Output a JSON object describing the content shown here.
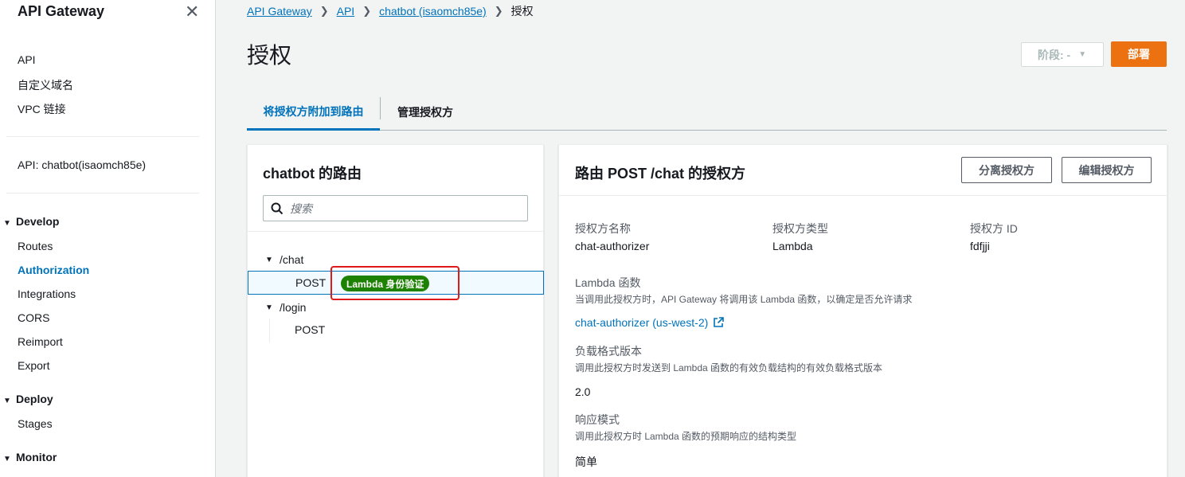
{
  "sidebar": {
    "title": "API Gateway",
    "links_top": [
      "API",
      "自定义域名",
      "VPC 链接"
    ],
    "api_label": "API: chatbot(isaomch85e)",
    "develop": {
      "label": "Develop",
      "items": [
        "Routes",
        "Authorization",
        "Integrations",
        "CORS",
        "Reimport",
        "Export"
      ],
      "active": "Authorization"
    },
    "deploy": {
      "label": "Deploy",
      "items": [
        "Stages"
      ]
    },
    "monitor": {
      "label": "Monitor"
    }
  },
  "breadcrumb": {
    "items": [
      "API Gateway",
      "API",
      "chatbot (isaomch85e)"
    ],
    "current": "授权"
  },
  "page": {
    "title": "授权",
    "stage_label": "阶段: -",
    "deploy_label": "部署"
  },
  "tabs": {
    "attach": "将授权方附加到路由",
    "manage": "管理授权方"
  },
  "routes_panel": {
    "title": "chatbot 的路由",
    "search_placeholder": "搜索",
    "routes": [
      {
        "path": "/chat",
        "method": "POST",
        "badge": "Lambda 身份验证",
        "selected": true
      },
      {
        "path": "/login",
        "method": "POST"
      }
    ]
  },
  "authorizer_panel": {
    "title": "路由 POST /chat 的授权方",
    "detach_label": "分离授权方",
    "edit_label": "编辑授权方",
    "name_label": "授权方名称",
    "name_value": "chat-authorizer",
    "type_label": "授权方类型",
    "type_value": "Lambda",
    "id_label": "授权方 ID",
    "id_value": "fdfjji",
    "lambda_label": "Lambda 函数",
    "lambda_desc": "当调用此授权方时，API Gateway 将调用该 Lambda 函数，以确定是否允许请求",
    "lambda_link": "chat-authorizer (us-west-2)",
    "payload_label": "负载格式版本",
    "payload_desc": "调用此授权方时发送到 Lambda 函数的有效负载结构的有效负载格式版本",
    "payload_value": "2.0",
    "response_label": "响应模式",
    "response_desc": "调用此授权方时 Lambda 函数的预期响应的结构类型",
    "response_value": "简单"
  },
  "colors": {
    "accent": "#0073bb",
    "primary_button": "#ec7211",
    "badge": "#1d8102",
    "highlight": "#e0191b"
  }
}
